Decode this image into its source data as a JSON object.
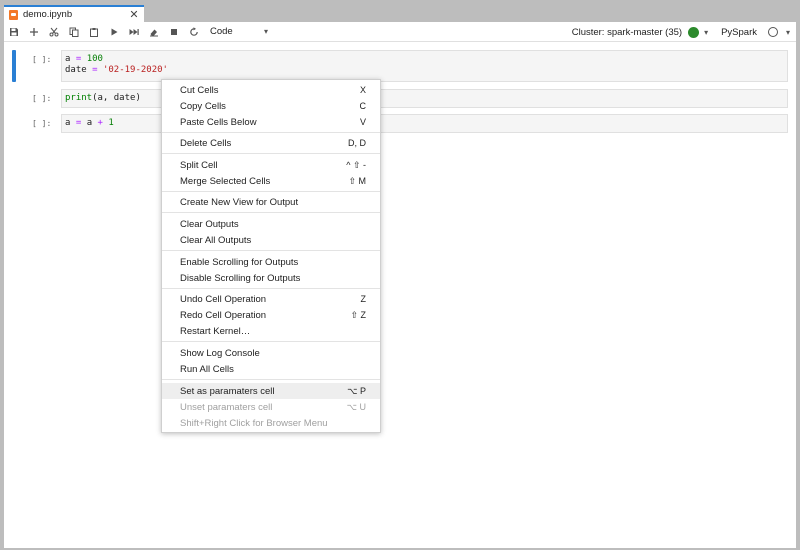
{
  "tab": {
    "title": "demo.ipynb",
    "close": "✕"
  },
  "toolbar": {
    "cell_type": "Code",
    "cluster": "Cluster: spark-master (35)",
    "kernel": "PySpark",
    "status_color": "#2c8a2c"
  },
  "cells": [
    {
      "prompt": "[ ]:",
      "line1": {
        "var": "a",
        "op": "=",
        "val": "100"
      },
      "line2": {
        "var": "date",
        "op": "=",
        "val": "'02-19-2020'"
      }
    },
    {
      "prompt": "[ ]:",
      "fn": "print",
      "args": "(a, date)"
    },
    {
      "prompt": "[ ]:",
      "var": "a",
      "op1": "=",
      "var2": "a",
      "op2": "+",
      "val": "1"
    }
  ],
  "context_menu": {
    "items": [
      {
        "label": "Cut Cells",
        "shortcut": "X"
      },
      {
        "label": "Copy Cells",
        "shortcut": "C"
      },
      {
        "label": "Paste Cells Below",
        "shortcut": "V"
      },
      {
        "label": "Delete Cells",
        "shortcut": "D, D"
      },
      {
        "label": "Split Cell",
        "shortcut": "^ ⇧ -"
      },
      {
        "label": "Merge Selected Cells",
        "shortcut": "⇧ M"
      },
      {
        "label": "Create New View for Output",
        "shortcut": ""
      },
      {
        "label": "Clear Outputs",
        "shortcut": ""
      },
      {
        "label": "Clear All Outputs",
        "shortcut": ""
      },
      {
        "label": "Enable Scrolling for Outputs",
        "shortcut": ""
      },
      {
        "label": "Disable Scrolling for Outputs",
        "shortcut": ""
      },
      {
        "label": "Undo Cell Operation",
        "shortcut": "Z"
      },
      {
        "label": "Redo Cell Operation",
        "shortcut": "⇧ Z"
      },
      {
        "label": "Restart Kernel…",
        "shortcut": ""
      },
      {
        "label": "Show Log Console",
        "shortcut": ""
      },
      {
        "label": "Run All Cells",
        "shortcut": ""
      },
      {
        "label": "Set as paramaters cell",
        "shortcut": "⌥ P"
      },
      {
        "label": "Unset paramaters cell",
        "shortcut": "⌥ U"
      },
      {
        "label": "Shift+Right Click for Browser Menu",
        "shortcut": ""
      }
    ]
  }
}
